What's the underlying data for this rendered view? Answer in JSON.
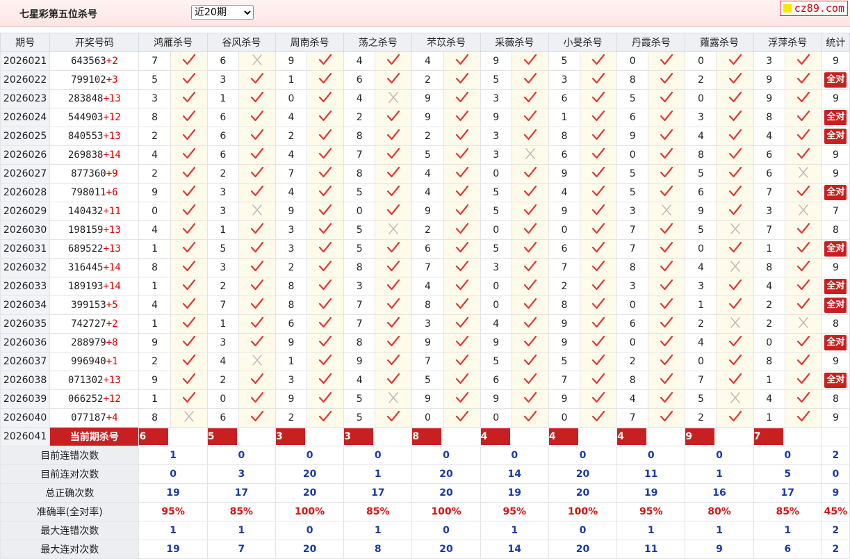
{
  "header": {
    "title": "七星彩第五位杀号",
    "range_selected": "近20期",
    "logo_text": "cz89.com"
  },
  "table": {
    "col_period": "期号",
    "col_open": "开奖号码",
    "col_stats": "统计",
    "experts": [
      "鸿雁杀号",
      "谷风杀号",
      "周南杀号",
      "荡之杀号",
      "芣苡杀号",
      "采薇杀号",
      "小旻杀号",
      "丹霞杀号",
      "蕹露杀号",
      "浮萍杀号"
    ],
    "all_correct_label": "全对",
    "rows": [
      {
        "period": "2026021",
        "main": "643563",
        "special": "+2",
        "kills": [
          [
            7,
            1
          ],
          [
            6,
            0
          ],
          [
            9,
            1
          ],
          [
            4,
            1
          ],
          [
            4,
            1
          ],
          [
            9,
            1
          ],
          [
            5,
            1
          ],
          [
            0,
            1
          ],
          [
            0,
            1
          ],
          [
            3,
            1
          ]
        ],
        "stat": "9"
      },
      {
        "period": "2026022",
        "main": "799102",
        "special": "+3",
        "kills": [
          [
            5,
            1
          ],
          [
            3,
            1
          ],
          [
            1,
            1
          ],
          [
            6,
            1
          ],
          [
            2,
            1
          ],
          [
            5,
            1
          ],
          [
            3,
            1
          ],
          [
            8,
            1
          ],
          [
            2,
            1
          ],
          [
            9,
            1
          ]
        ],
        "stat": "全对"
      },
      {
        "period": "2026023",
        "main": "283848",
        "special": "+13",
        "kills": [
          [
            3,
            1
          ],
          [
            1,
            1
          ],
          [
            0,
            1
          ],
          [
            4,
            0
          ],
          [
            9,
            1
          ],
          [
            3,
            1
          ],
          [
            6,
            1
          ],
          [
            5,
            1
          ],
          [
            0,
            1
          ],
          [
            9,
            1
          ]
        ],
        "stat": "9"
      },
      {
        "period": "2026024",
        "main": "544903",
        "special": "+12",
        "kills": [
          [
            8,
            1
          ],
          [
            6,
            1
          ],
          [
            4,
            1
          ],
          [
            2,
            1
          ],
          [
            9,
            1
          ],
          [
            9,
            1
          ],
          [
            1,
            1
          ],
          [
            6,
            1
          ],
          [
            3,
            1
          ],
          [
            8,
            1
          ]
        ],
        "stat": "全对"
      },
      {
        "period": "2026025",
        "main": "840553",
        "special": "+13",
        "kills": [
          [
            2,
            1
          ],
          [
            6,
            1
          ],
          [
            2,
            1
          ],
          [
            8,
            1
          ],
          [
            2,
            1
          ],
          [
            3,
            1
          ],
          [
            8,
            1
          ],
          [
            9,
            1
          ],
          [
            4,
            1
          ],
          [
            4,
            1
          ]
        ],
        "stat": "全对"
      },
      {
        "period": "2026026",
        "main": "269838",
        "special": "+14",
        "kills": [
          [
            4,
            1
          ],
          [
            6,
            1
          ],
          [
            4,
            1
          ],
          [
            7,
            1
          ],
          [
            5,
            1
          ],
          [
            3,
            0
          ],
          [
            6,
            1
          ],
          [
            0,
            1
          ],
          [
            8,
            1
          ],
          [
            6,
            1
          ]
        ],
        "stat": "9"
      },
      {
        "period": "2026027",
        "main": "877360",
        "special": "+9",
        "kills": [
          [
            2,
            1
          ],
          [
            2,
            1
          ],
          [
            7,
            1
          ],
          [
            8,
            1
          ],
          [
            4,
            1
          ],
          [
            0,
            1
          ],
          [
            9,
            1
          ],
          [
            5,
            1
          ],
          [
            5,
            1
          ],
          [
            6,
            0
          ]
        ],
        "stat": "9"
      },
      {
        "period": "2026028",
        "main": "798011",
        "special": "+6",
        "kills": [
          [
            9,
            1
          ],
          [
            3,
            1
          ],
          [
            4,
            1
          ],
          [
            5,
            1
          ],
          [
            4,
            1
          ],
          [
            5,
            1
          ],
          [
            4,
            1
          ],
          [
            5,
            1
          ],
          [
            6,
            1
          ],
          [
            7,
            1
          ]
        ],
        "stat": "全对"
      },
      {
        "period": "2026029",
        "main": "140432",
        "special": "+11",
        "kills": [
          [
            0,
            1
          ],
          [
            3,
            0
          ],
          [
            9,
            1
          ],
          [
            0,
            1
          ],
          [
            9,
            1
          ],
          [
            5,
            1
          ],
          [
            9,
            1
          ],
          [
            3,
            0
          ],
          [
            9,
            1
          ],
          [
            3,
            0
          ]
        ],
        "stat": "7"
      },
      {
        "period": "2026030",
        "main": "198159",
        "special": "+13",
        "kills": [
          [
            4,
            1
          ],
          [
            1,
            1
          ],
          [
            3,
            1
          ],
          [
            5,
            0
          ],
          [
            2,
            1
          ],
          [
            0,
            1
          ],
          [
            0,
            1
          ],
          [
            7,
            1
          ],
          [
            5,
            0
          ],
          [
            7,
            1
          ]
        ],
        "stat": "8"
      },
      {
        "period": "2026031",
        "main": "689522",
        "special": "+13",
        "kills": [
          [
            1,
            1
          ],
          [
            5,
            1
          ],
          [
            3,
            1
          ],
          [
            5,
            1
          ],
          [
            6,
            1
          ],
          [
            5,
            1
          ],
          [
            6,
            1
          ],
          [
            7,
            1
          ],
          [
            0,
            1
          ],
          [
            1,
            1
          ]
        ],
        "stat": "全对"
      },
      {
        "period": "2026032",
        "main": "316445",
        "special": "+14",
        "kills": [
          [
            8,
            1
          ],
          [
            3,
            1
          ],
          [
            2,
            1
          ],
          [
            8,
            1
          ],
          [
            7,
            1
          ],
          [
            3,
            1
          ],
          [
            7,
            1
          ],
          [
            8,
            1
          ],
          [
            4,
            0
          ],
          [
            8,
            1
          ]
        ],
        "stat": "9"
      },
      {
        "period": "2026033",
        "main": "189193",
        "special": "+14",
        "kills": [
          [
            1,
            1
          ],
          [
            2,
            1
          ],
          [
            8,
            1
          ],
          [
            3,
            1
          ],
          [
            4,
            1
          ],
          [
            0,
            1
          ],
          [
            2,
            1
          ],
          [
            3,
            1
          ],
          [
            3,
            1
          ],
          [
            4,
            1
          ]
        ],
        "stat": "全对"
      },
      {
        "period": "2026034",
        "main": "399153",
        "special": "+5",
        "kills": [
          [
            4,
            1
          ],
          [
            7,
            1
          ],
          [
            8,
            1
          ],
          [
            7,
            1
          ],
          [
            8,
            1
          ],
          [
            0,
            1
          ],
          [
            8,
            1
          ],
          [
            0,
            1
          ],
          [
            1,
            1
          ],
          [
            2,
            1
          ]
        ],
        "stat": "全对"
      },
      {
        "period": "2026035",
        "main": "742727",
        "special": "+2",
        "kills": [
          [
            1,
            1
          ],
          [
            1,
            1
          ],
          [
            6,
            1
          ],
          [
            7,
            1
          ],
          [
            3,
            1
          ],
          [
            4,
            1
          ],
          [
            9,
            1
          ],
          [
            6,
            1
          ],
          [
            2,
            0
          ],
          [
            2,
            0
          ]
        ],
        "stat": "8"
      },
      {
        "period": "2026036",
        "main": "288979",
        "special": "+8",
        "kills": [
          [
            9,
            1
          ],
          [
            3,
            1
          ],
          [
            9,
            1
          ],
          [
            8,
            1
          ],
          [
            9,
            1
          ],
          [
            9,
            1
          ],
          [
            9,
            1
          ],
          [
            0,
            1
          ],
          [
            4,
            1
          ],
          [
            0,
            1
          ]
        ],
        "stat": "全对"
      },
      {
        "period": "2026037",
        "main": "996940",
        "special": "+1",
        "kills": [
          [
            2,
            1
          ],
          [
            4,
            0
          ],
          [
            1,
            1
          ],
          [
            9,
            1
          ],
          [
            7,
            1
          ],
          [
            5,
            1
          ],
          [
            5,
            1
          ],
          [
            2,
            1
          ],
          [
            0,
            1
          ],
          [
            8,
            1
          ]
        ],
        "stat": "9"
      },
      {
        "period": "2026038",
        "main": "071302",
        "special": "+13",
        "kills": [
          [
            9,
            1
          ],
          [
            2,
            1
          ],
          [
            3,
            1
          ],
          [
            4,
            1
          ],
          [
            5,
            1
          ],
          [
            6,
            1
          ],
          [
            7,
            1
          ],
          [
            8,
            1
          ],
          [
            7,
            1
          ],
          [
            1,
            1
          ]
        ],
        "stat": "全对"
      },
      {
        "period": "2026039",
        "main": "066252",
        "special": "+12",
        "kills": [
          [
            1,
            1
          ],
          [
            0,
            1
          ],
          [
            9,
            1
          ],
          [
            5,
            0
          ],
          [
            9,
            1
          ],
          [
            9,
            1
          ],
          [
            9,
            1
          ],
          [
            4,
            1
          ],
          [
            5,
            0
          ],
          [
            4,
            1
          ]
        ],
        "stat": "8"
      },
      {
        "period": "2026040",
        "main": "077187",
        "special": "+4",
        "kills": [
          [
            8,
            0
          ],
          [
            6,
            1
          ],
          [
            2,
            1
          ],
          [
            5,
            1
          ],
          [
            0,
            1
          ],
          [
            0,
            1
          ],
          [
            0,
            1
          ],
          [
            7,
            1
          ],
          [
            2,
            1
          ],
          [
            1,
            1
          ]
        ],
        "stat": "9"
      }
    ],
    "current": {
      "period": "2026041",
      "label": "当前期杀号",
      "kills": [
        6,
        5,
        3,
        3,
        8,
        4,
        4,
        4,
        9,
        7
      ]
    },
    "summary": [
      {
        "label": "目前连错次数",
        "values": [
          "1",
          "0",
          "0",
          "0",
          "0",
          "0",
          "0",
          "0",
          "0",
          "0"
        ],
        "stat": "2",
        "color": "blue"
      },
      {
        "label": "目前连对次数",
        "values": [
          "0",
          "3",
          "20",
          "1",
          "20",
          "14",
          "20",
          "11",
          "1",
          "5"
        ],
        "stat": "0",
        "color": "blue"
      },
      {
        "label": "总正确次数",
        "values": [
          "19",
          "17",
          "20",
          "17",
          "20",
          "19",
          "20",
          "19",
          "16",
          "17"
        ],
        "stat": "9",
        "color": "blue"
      },
      {
        "label": "准确率(全对率)",
        "values": [
          "95%",
          "85%",
          "100%",
          "85%",
          "100%",
          "95%",
          "100%",
          "95%",
          "80%",
          "85%"
        ],
        "stat": "45%",
        "color": "red"
      },
      {
        "label": "最大连错次数",
        "values": [
          "1",
          "1",
          "0",
          "1",
          "0",
          "1",
          "0",
          "1",
          "1",
          "1"
        ],
        "stat": "2",
        "color": "blue"
      },
      {
        "label": "最大连对次数",
        "values": [
          "19",
          "7",
          "20",
          "8",
          "20",
          "14",
          "20",
          "11",
          "9",
          "6"
        ],
        "stat": "2",
        "color": "blue"
      }
    ]
  }
}
